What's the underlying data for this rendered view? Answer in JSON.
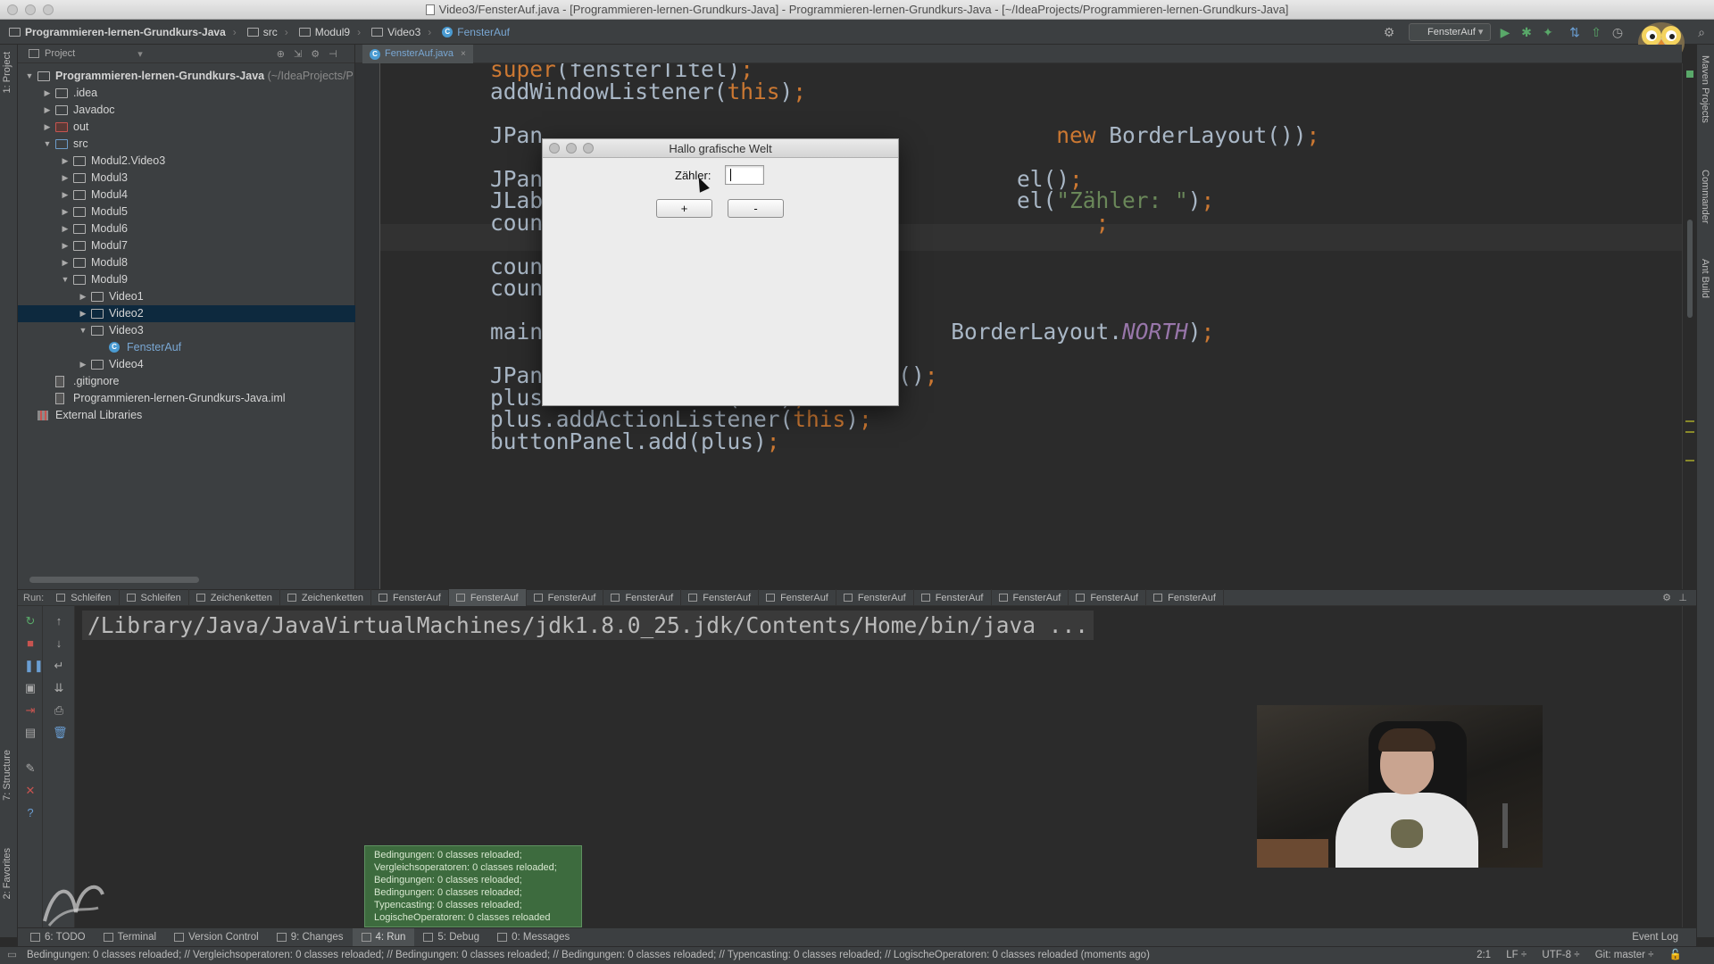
{
  "window": {
    "title": "Video3/FensterAuf.java - [Programmieren-lernen-Grundkurs-Java] - Programmieren-lernen-Grundkurs-Java - [~/IdeaProjects/Programmieren-lernen-Grundkurs-Java]"
  },
  "breadcrumbs": [
    "Programmieren-lernen-Grundkurs-Java",
    "src",
    "Modul9",
    "Video3",
    "FensterAuf"
  ],
  "toolbar": {
    "run_config": "FensterAuf"
  },
  "tool_strips": {
    "left_top": "1: Project",
    "left_structure": "7: Structure",
    "left_favorites": "2: Favorites",
    "right_maven": "Maven Projects",
    "right_commander": "Commander",
    "right_ant": "Ant Build"
  },
  "project": {
    "header": "Project",
    "tree": [
      {
        "label": "Programmieren-lernen-Grundkurs-Java",
        "suffix": "(~/IdeaProjects/P",
        "indent": 0,
        "arrow": "▼",
        "bold": true
      },
      {
        "label": ".idea",
        "indent": 1,
        "arrow": "▶"
      },
      {
        "label": "Javadoc",
        "indent": 1,
        "arrow": "▶"
      },
      {
        "label": "out",
        "indent": 1,
        "arrow": "▶",
        "red": true
      },
      {
        "label": "src",
        "indent": 1,
        "arrow": "▼",
        "blue": true
      },
      {
        "label": "Modul2.Video3",
        "indent": 2,
        "arrow": "▶"
      },
      {
        "label": "Modul3",
        "indent": 2,
        "arrow": "▶"
      },
      {
        "label": "Modul4",
        "indent": 2,
        "arrow": "▶"
      },
      {
        "label": "Modul5",
        "indent": 2,
        "arrow": "▶"
      },
      {
        "label": "Modul6",
        "indent": 2,
        "arrow": "▶"
      },
      {
        "label": "Modul7",
        "indent": 2,
        "arrow": "▶"
      },
      {
        "label": "Modul8",
        "indent": 2,
        "arrow": "▶"
      },
      {
        "label": "Modul9",
        "indent": 2,
        "arrow": "▼"
      },
      {
        "label": "Video1",
        "indent": 3,
        "arrow": "▶"
      },
      {
        "label": "Video2",
        "indent": 3,
        "arrow": "▶",
        "selected": true
      },
      {
        "label": "Video3",
        "indent": 3,
        "arrow": "▼"
      },
      {
        "label": "FensterAuf",
        "indent": 4,
        "arrow": "",
        "cls": true
      },
      {
        "label": "Video4",
        "indent": 3,
        "arrow": "▶"
      },
      {
        "label": ".gitignore",
        "indent": 1,
        "arrow": "",
        "file": true
      },
      {
        "label": "Programmieren-lernen-Grundkurs-Java.iml",
        "indent": 1,
        "arrow": "",
        "file": true
      },
      {
        "label": "External Libraries",
        "indent": 0,
        "arrow": "",
        "lib": true
      }
    ]
  },
  "editor": {
    "tab": "FensterAuf.java",
    "lines": [
      [
        {
          "t": "super",
          "c": "kw"
        },
        {
          "t": "(fensterTitel)"
        },
        {
          "t": ";",
          "c": "kw"
        }
      ],
      [
        {
          "t": "addWindowListener("
        },
        {
          "t": "this",
          "c": "kw"
        },
        {
          "t": ")"
        },
        {
          "t": ";",
          "c": "kw"
        }
      ],
      [],
      [
        {
          "t": "JPan                                       "
        },
        {
          "t": "new ",
          "c": "kw"
        },
        {
          "t": "BorderLayout())"
        },
        {
          "t": ";",
          "c": "kw"
        }
      ],
      [],
      [
        {
          "t": "JPan                                    el()"
        },
        {
          "t": ";",
          "c": "kw"
        }
      ],
      [
        {
          "t": "JLab                                    el("
        },
        {
          "t": "\"Zähler: \"",
          "c": "str"
        },
        {
          "t": ")"
        },
        {
          "t": ";",
          "c": "kw"
        }
      ],
      [
        {
          "t": "coun                                          "
        },
        {
          "t": ";",
          "c": "kw"
        }
      ],
      [],
      [
        {
          "t": "coun"
        }
      ],
      [
        {
          "t": "coun"
        }
      ],
      [],
      [
        {
          "t": "main                               BorderLayout."
        },
        {
          "t": "NORTH",
          "c": "it"
        },
        {
          "t": ")"
        },
        {
          "t": ";",
          "c": "kw"
        }
      ],
      [],
      [
        {
          "t": "JPanel buttonPanel = "
        },
        {
          "t": "new ",
          "c": "kw"
        },
        {
          "t": "JPanel()"
        },
        {
          "t": ";",
          "c": "kw"
        }
      ],
      [
        {
          "t": "plus = "
        },
        {
          "t": "new ",
          "c": "kw"
        },
        {
          "t": "JButton("
        },
        {
          "t": "\"+\"",
          "c": "str"
        },
        {
          "t": ")"
        },
        {
          "t": ";",
          "c": "kw"
        }
      ],
      [
        {
          "t": "plus.addActionListener("
        },
        {
          "t": "this",
          "c": "kw"
        },
        {
          "t": ")"
        },
        {
          "t": ";",
          "c": "kw"
        }
      ],
      [
        {
          "t": "buttonPanel.add(plus)"
        },
        {
          "t": ";",
          "c": "kw"
        }
      ]
    ]
  },
  "dialog": {
    "title": "Hallo grafische Welt",
    "counter_label": "Zähler:",
    "counter_value": "",
    "plus_label": "+",
    "minus_label": "-"
  },
  "run": {
    "label": "Run:",
    "tabs": [
      "Schleifen",
      "Schleifen",
      "Zeichenketten",
      "Zeichenketten",
      "FensterAuf",
      "FensterAuf",
      "FensterAuf",
      "FensterAuf",
      "FensterAuf",
      "FensterAuf",
      "FensterAuf",
      "FensterAuf",
      "FensterAuf",
      "FensterAuf",
      "FensterAuf"
    ],
    "active_tab": 5,
    "console_line": "/Library/Java/JavaVirtualMachines/jdk1.8.0_25.jdk/Contents/Home/bin/java ..."
  },
  "notification": [
    "Bedingungen: 0 classes reloaded;",
    "Vergleichsoperatoren: 0 classes reloaded;",
    "Bedingungen: 0 classes reloaded;",
    "Bedingungen: 0 classes reloaded;",
    "Typencasting: 0 classes reloaded;",
    "LogischeOperatoren: 0 classes reloaded"
  ],
  "bottom_tools": [
    {
      "label": "6: TODO",
      "active": false
    },
    {
      "label": "Terminal",
      "active": false
    },
    {
      "label": "Version Control",
      "active": false
    },
    {
      "label": "9: Changes",
      "active": false
    },
    {
      "label": "4: Run",
      "active": true
    },
    {
      "label": "5: Debug",
      "active": false
    },
    {
      "label": "0: Messages",
      "active": false
    }
  ],
  "event_log": "Event Log",
  "status": {
    "message": "Bedingungen: 0 classes reloaded; // Vergleichsoperatoren: 0 classes reloaded; // Bedingungen: 0 classes reloaded; // Bedingungen: 0 classes reloaded; // Typencasting: 0 classes reloaded; // LogischeOperatoren: 0 classes reloaded (moments ago)",
    "position": "2:1",
    "line_sep": "LF ÷",
    "encoding": "UTF-8 ÷",
    "git": "Git: master ÷"
  },
  "colors": {
    "keyword": "#cc7832",
    "string": "#6a8759",
    "constant": "#9876aa",
    "selection": "#0d293e",
    "notification_bg": "#3d6b3e"
  }
}
